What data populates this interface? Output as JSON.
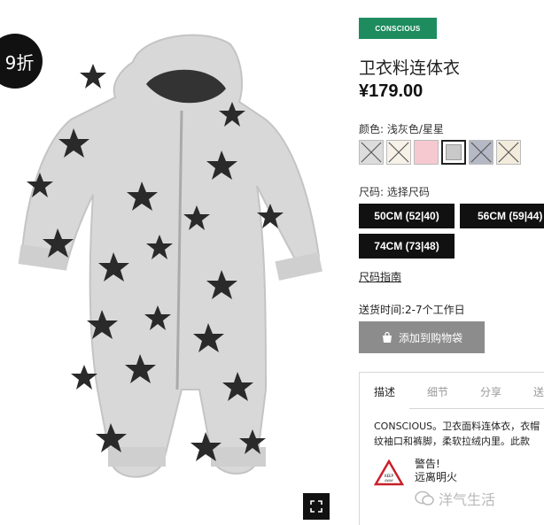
{
  "badge": {
    "discount_text": "9折"
  },
  "product": {
    "tag": "CONSCIOUS",
    "title": "卫衣料连体衣",
    "price": "¥179.00"
  },
  "colors": {
    "label": "颜色: 浅灰色/星星",
    "swatches": [
      {
        "name": "swatch-1",
        "color": "#dcdcdc",
        "crossed": true,
        "selected": false
      },
      {
        "name": "swatch-2",
        "color": "#f7f2e8",
        "crossed": true,
        "selected": false
      },
      {
        "name": "swatch-3",
        "color": "#f6c9d0",
        "crossed": false,
        "selected": false
      },
      {
        "name": "swatch-4",
        "color": "#c9c9c9",
        "crossed": false,
        "selected": true
      },
      {
        "name": "swatch-5",
        "color": "#b5b8c5",
        "crossed": true,
        "selected": false
      },
      {
        "name": "swatch-6",
        "color": "#f3ecdc",
        "crossed": true,
        "selected": false
      }
    ]
  },
  "sizes": {
    "label": "尺码: 选择尺码",
    "options": [
      "50CM (52|40)",
      "56CM (59|44)",
      "74CM (73|48)"
    ]
  },
  "size_guide": "尺码指南",
  "delivery": "送货时间:2-7个工作日",
  "add_to_bag": "添加到购物袋",
  "tabs": [
    "描述",
    "细节",
    "分享",
    "送"
  ],
  "description": {
    "line1": "CONSCIOUS。卫衣面料连体衣，衣帽",
    "line2": "纹袖口和裤脚，柔软拉绒内里。此款"
  },
  "warning": {
    "title": "警告!",
    "text": "远离明火",
    "icon_text": "KEEP AWAY FROM FIRE"
  },
  "watermark": "洋气生活"
}
